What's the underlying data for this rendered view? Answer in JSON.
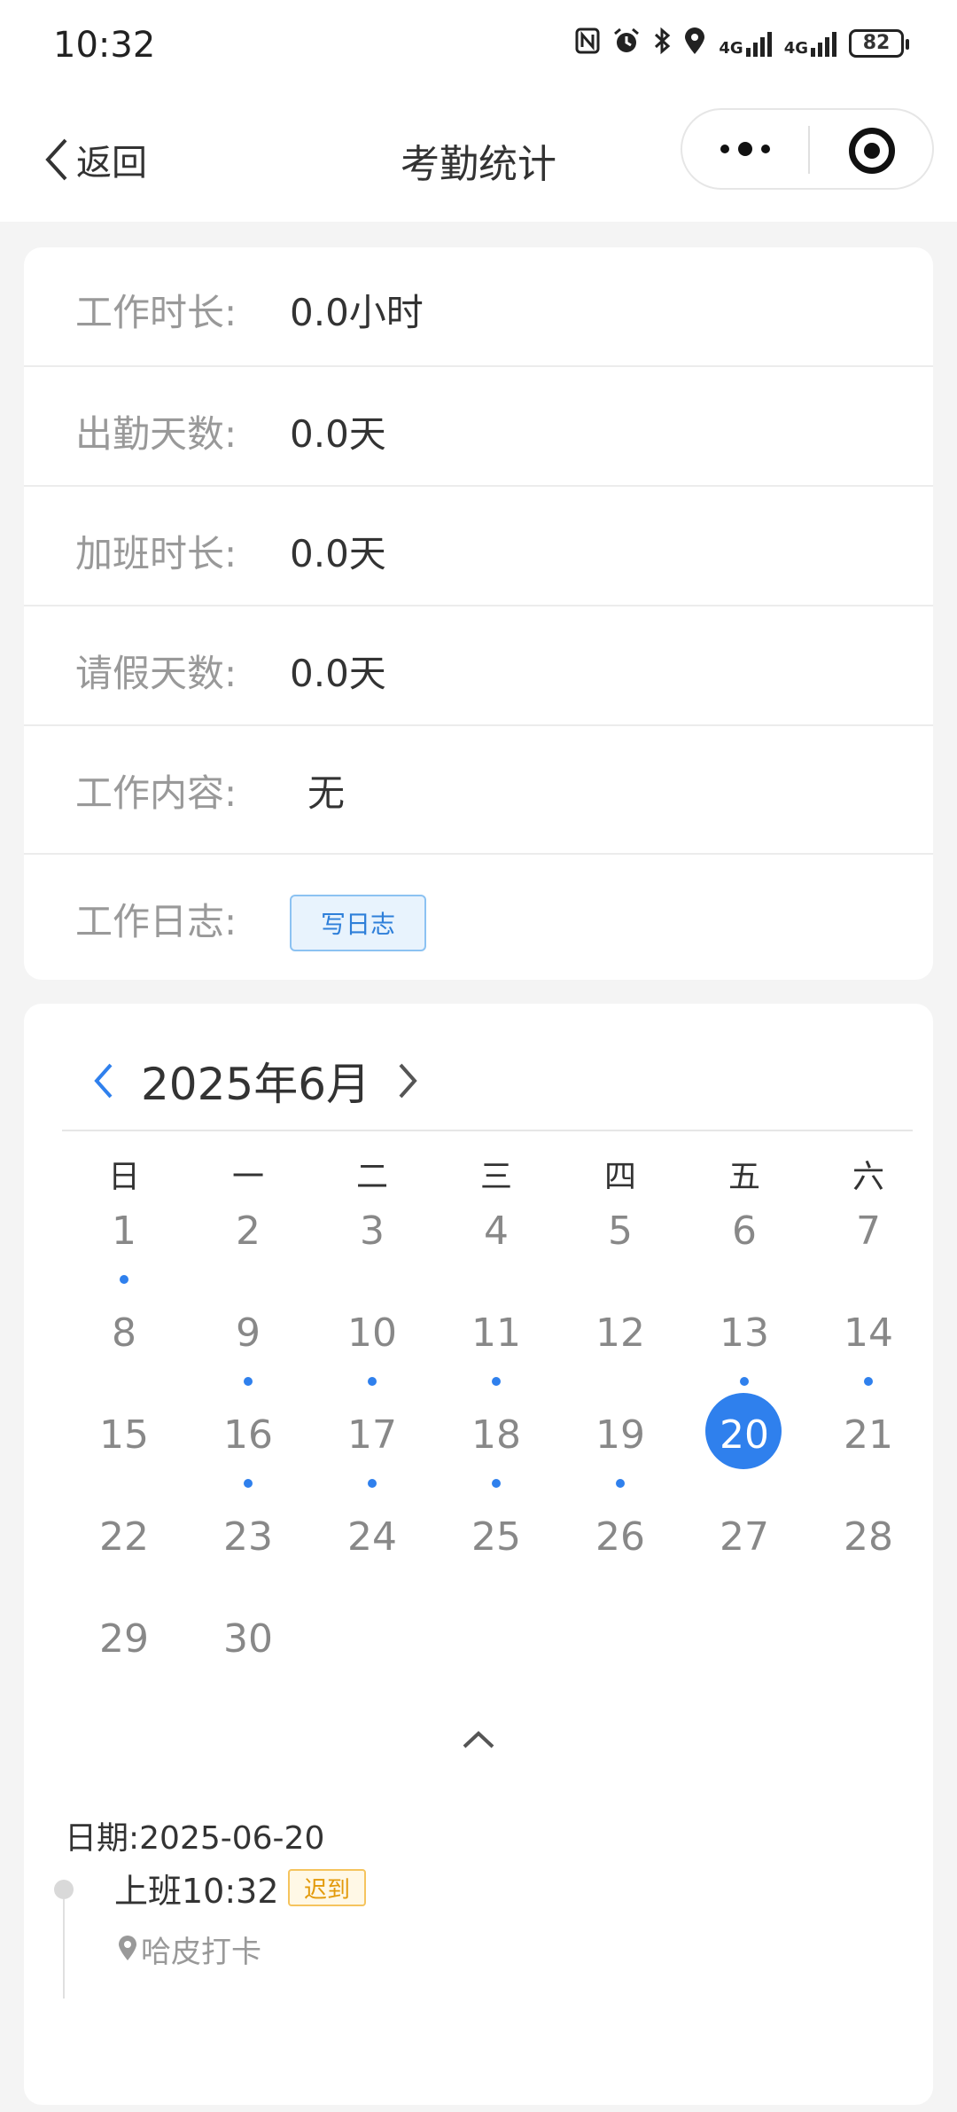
{
  "status_bar": {
    "time": "10:32",
    "network_labels": [
      "4G",
      "4G"
    ],
    "battery": "82",
    "icons": [
      "nfc-icon",
      "alarm-icon",
      "bluetooth-icon",
      "location-icon",
      "signal-icon",
      "signal-icon",
      "battery-icon"
    ]
  },
  "nav": {
    "back_label": "返回",
    "title": "考勤统计"
  },
  "stats": {
    "work_hours_label": "工作时长:",
    "work_hours_value": "0.0小时",
    "attendance_days_label": "出勤天数:",
    "attendance_days_value": "0.0天",
    "overtime_label": "加班时长:",
    "overtime_value": "0.0天",
    "leave_days_label": "请假天数:",
    "leave_days_value": "0.0天",
    "work_content_label": "工作内容:",
    "work_content_value": "无",
    "work_log_label": "工作日志:",
    "write_log_button": "写日志"
  },
  "calendar": {
    "month_title": "2025年6月",
    "weekdays": [
      "日",
      "一",
      "二",
      "三",
      "四",
      "五",
      "六"
    ],
    "first_weekday": 0,
    "days_in_month": 30,
    "selected_day": 20,
    "days_with_records": [
      1,
      9,
      10,
      11,
      13,
      14,
      16,
      17,
      18,
      19
    ],
    "accent_color": "#2f80ed"
  },
  "record": {
    "date_label": "日期:",
    "date_value": "2025-06-20",
    "clock_in": "上班10:32",
    "status_tag": "迟到",
    "location": "哈皮打卡",
    "status_color": "#e39a0b"
  }
}
